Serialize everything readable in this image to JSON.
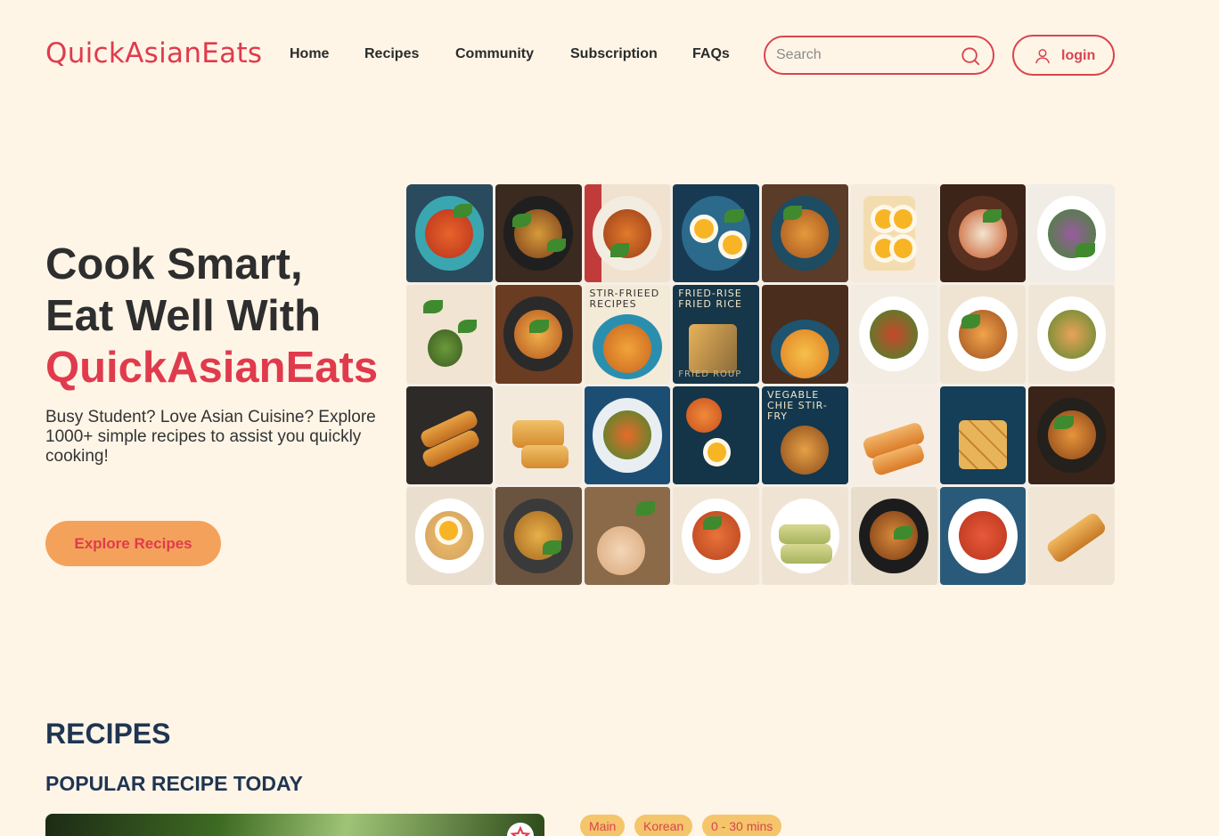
{
  "header": {
    "logo": "QuickAsianEats",
    "nav": [
      "Home",
      "Recipes",
      "Community",
      "Subscription",
      "FAQs"
    ],
    "search": {
      "placeholder": "Search",
      "icon": "search-icon"
    },
    "login": {
      "label": "login",
      "icon": "user-icon"
    }
  },
  "hero": {
    "title_line1": "Cook Smart,",
    "title_line2": "Eat Well With",
    "title_brand": "QuickAsianEats",
    "subtitle": "Busy Student? Love Asian Cuisine? Explore 1000+ simple recipes to assist you quickly cooking!",
    "cta_label": "Explore Recipes",
    "image_captions": [
      "STIR-FRIEED RECIPES",
      "FRIED-RISE FRIED RICE",
      "FRIED ROUP",
      "VEGABLE CHIE STIR-FRY"
    ]
  },
  "recipes": {
    "title": "RECIPES",
    "popular_title": "POPULAR RECIPE TODAY",
    "tags": [
      "Main",
      "Korean",
      "0 - 30 mins"
    ]
  },
  "colors": {
    "background": "#fef5e7",
    "accent_red": "#e03b4c",
    "button_orange": "#f4a25b",
    "heading_navy": "#1f3552",
    "tag_yellow": "#f4c56a"
  }
}
